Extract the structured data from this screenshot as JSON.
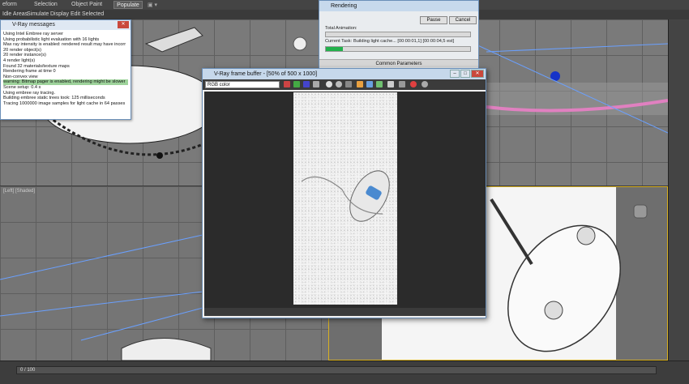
{
  "ribbon": {
    "tabs": [
      "eform",
      "Selection",
      "Object Paint",
      "Populate"
    ],
    "subtabs": [
      "Idle Areas",
      "Simulate",
      "Display",
      "Edit Selected"
    ]
  },
  "vray_messages": {
    "title": "V-Ray messages",
    "lines": [
      {
        "text": "Using Intel Embree ray server",
        "hl": false
      },
      {
        "text": "Using probabilistic light evaluation with 16 lights",
        "hl": false
      },
      {
        "text": "Max ray intensity is enabled: rendered result may have incorr",
        "hl": false
      },
      {
        "text": "20 render object(s)",
        "hl": false
      },
      {
        "text": "20 render instance(s)",
        "hl": false
      },
      {
        "text": "4 render light(s)",
        "hl": false
      },
      {
        "text": "Found 32 materials/texture maps",
        "hl": false
      },
      {
        "text": "Rendering frame at time 0",
        "hl": false
      },
      {
        "text": "Non-convex view",
        "hl": false
      },
      {
        "text": "warning: Bitmap pager is enabled, rendering might be slower",
        "hl": true
      },
      {
        "text": "Scene setup: 0.4 s",
        "hl": false
      },
      {
        "text": "Using embree ray tracing.",
        "hl": false
      },
      {
        "text": "Building embree static trees took: 125 milliseconds",
        "hl": false
      },
      {
        "text": "Tracing 1000000 image samples for light cache in 64 passes",
        "hl": false
      }
    ]
  },
  "rendering": {
    "title": "Rendering",
    "pause_label": "Pause",
    "cancel_label": "Cancel",
    "total_animation_label": "Total Animation:",
    "current_task_label": "Current Task:",
    "current_task_value": "Building light cache... [00:00:01,1] [00:00:04,5 est]",
    "current_task_progress": 0.12,
    "section_label": "Common Parameters"
  },
  "vfb": {
    "title": "V-Ray frame buffer - [50% of 500 x 1000]",
    "channel": "RGB color"
  },
  "timeline": {
    "label": "0 / 100"
  },
  "viewports": {
    "top_label": "",
    "left_label": "[Left] [Shaded]",
    "persp_label": ""
  },
  "colors": {
    "accent_highlight": "#9ed39b",
    "progress_green": "#22b14c",
    "active_viewport_border": "#d8b020"
  }
}
